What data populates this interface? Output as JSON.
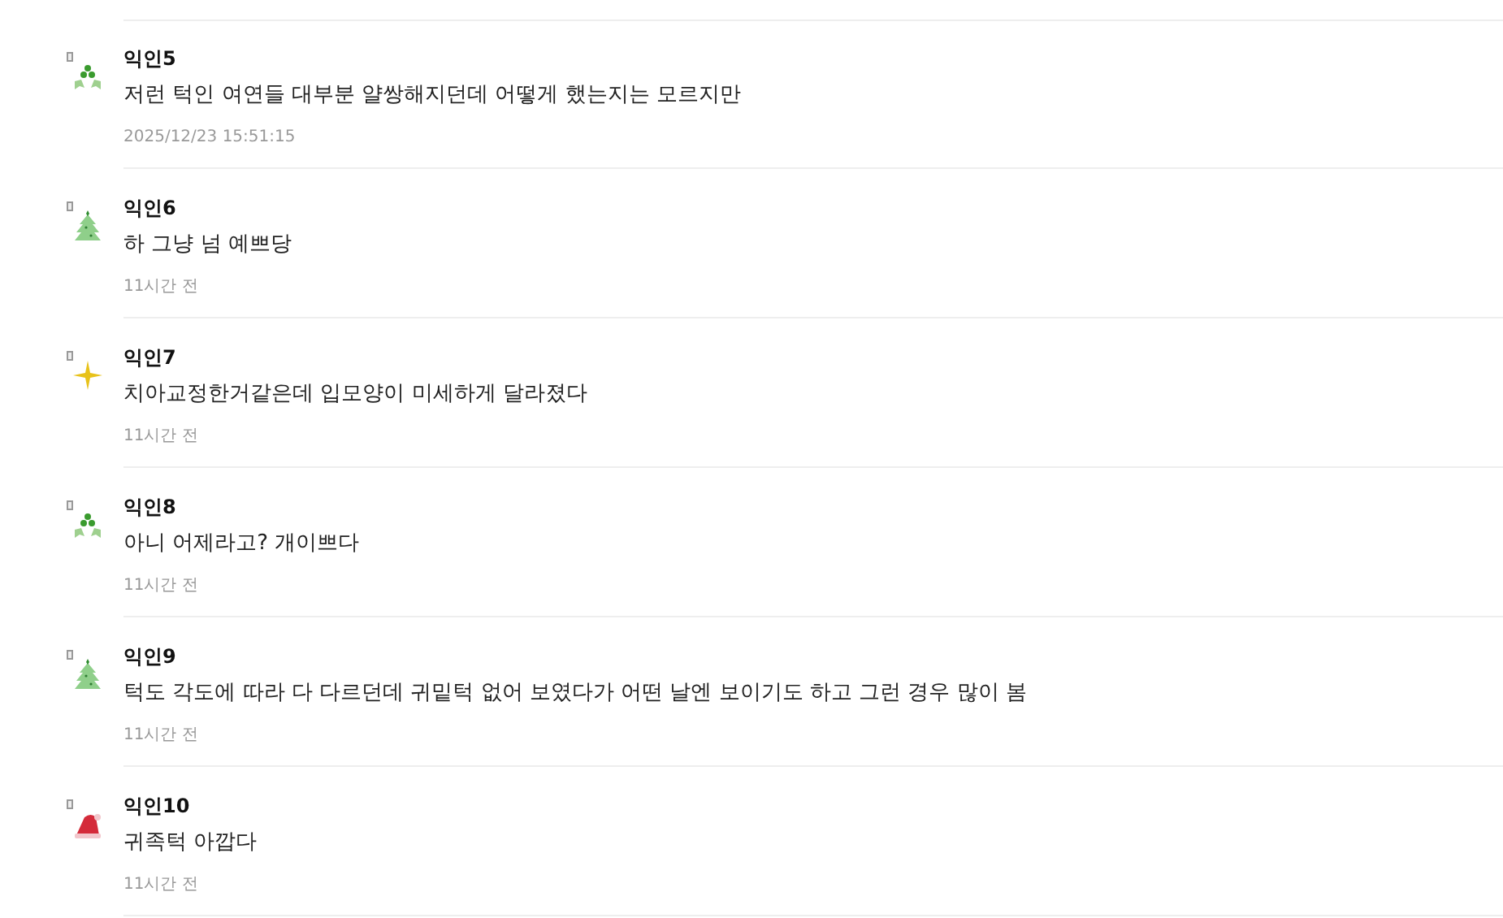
{
  "comments": [
    {
      "author": "익인5",
      "avatar": {
        "kind": "clover"
      },
      "text": "저런 턱인 여연들 대부분 얄쌍해지던데 어떻게 했는지는 모르지만",
      "time": "2025/12/23 15:51:15"
    },
    {
      "author": "익인6",
      "avatar": {
        "kind": "tree"
      },
      "text": "하 그냥 넘 예쁘당",
      "time": "11시간 전"
    },
    {
      "author": "익인7",
      "avatar": {
        "kind": "sparkle"
      },
      "text": "치아교정한거같은데 입모양이 미세하게 달라졌다",
      "time": "11시간 전"
    },
    {
      "author": "익인8",
      "avatar": {
        "kind": "clover"
      },
      "text": "아니 어제라고? 개이쁘다",
      "time": "11시간 전"
    },
    {
      "author": "익인9",
      "avatar": {
        "kind": "tree"
      },
      "text": "턱도 각도에 따라 다 다르던데 귀밑턱 없어 보였다가 어떤 날엔 보이기도 하고 그런 경우 많이 봄",
      "time": "11시간 전"
    },
    {
      "author": "익인10",
      "avatar": {
        "kind": "hat"
      },
      "text": "귀족턱 아깝다",
      "time": "11시간 전"
    }
  ]
}
